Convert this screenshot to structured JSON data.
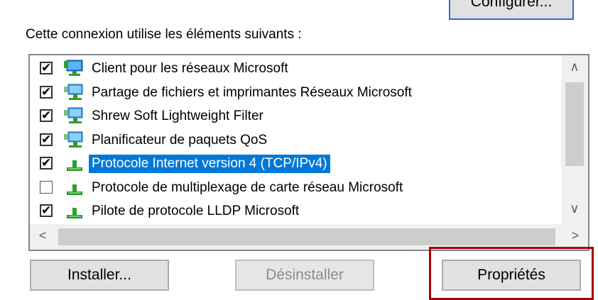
{
  "top_button": {
    "label": "Configurer..."
  },
  "header": "Cette connexion utilise les éléments suivants :",
  "items": [
    {
      "label": "Client pour les réseaux Microsoft",
      "checked": true,
      "icon": "network-client-icon"
    },
    {
      "label": "Partage de fichiers et imprimantes Réseaux Microsoft",
      "checked": true,
      "icon": "network-service-icon"
    },
    {
      "label": "Shrew Soft Lightweight Filter",
      "checked": true,
      "icon": "network-service-icon"
    },
    {
      "label": "Planificateur de paquets QoS",
      "checked": true,
      "icon": "network-service-icon"
    },
    {
      "label": "Protocole Internet version 4 (TCP/IPv4)",
      "checked": true,
      "selected": true,
      "icon": "network-protocol-icon"
    },
    {
      "label": "Protocole de multiplexage de carte réseau Microsoft",
      "checked": false,
      "icon": "network-protocol-icon"
    },
    {
      "label": "Pilote de protocole LLDP Microsoft",
      "checked": true,
      "icon": "network-protocol-icon"
    }
  ],
  "checkmark": "✔",
  "scroll": {
    "up": "∧",
    "down": "∨",
    "left": "<",
    "right": ">"
  },
  "buttons": {
    "install": "Installer...",
    "uninstall": "Désinstaller",
    "properties": "Propriétés"
  },
  "colors": {
    "selection": "#0078d7",
    "highlight_box": "#a40000"
  }
}
